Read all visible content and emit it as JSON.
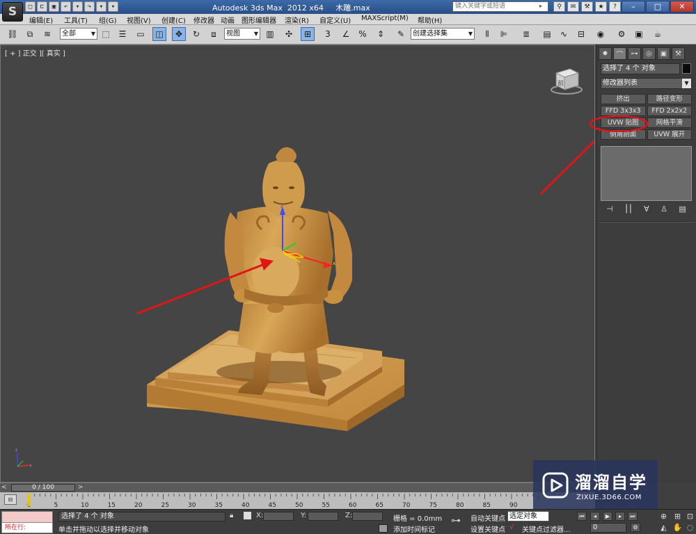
{
  "titlebar": {
    "title": "Autodesk 3ds Max  2012 x64     木雕.max",
    "search_placeholder": "键入关键字或短语",
    "app_logo": "3ds-max-logo",
    "window_controls": [
      "minimize",
      "maximize",
      "close"
    ]
  },
  "menu": {
    "items": [
      "编辑(E)",
      "工具(T)",
      "组(G)",
      "视图(V)",
      "创建(C)",
      "修改器",
      "动画",
      "图形编辑器",
      "渲染(R)",
      "自定义(U)",
      "MAXScript(M)",
      "帮助(H)"
    ]
  },
  "toolbar": {
    "selection_filter": "全部",
    "ref_coord": "视图",
    "named_selection": "创建选择集",
    "icons": [
      "link-icon",
      "unlink-icon",
      "bind-spacewarp-icon",
      "select-object-icon",
      "select-by-name-icon",
      "rect-selection-icon",
      "window-crossing-icon",
      "move-icon",
      "rotate-icon",
      "scale-icon",
      "pivot-icon",
      "manipulate-icon",
      "keyboard-shortcut-icon",
      "snap-3d-icon",
      "angle-snap-icon",
      "percent-snap-icon",
      "spinner-snap-icon",
      "edit-named-selection-icon",
      "mirror-icon",
      "align-icon",
      "layer-manager-icon",
      "ribbon-icon",
      "curve-editor-icon",
      "schematic-view-icon",
      "material-editor-icon",
      "render-setup-icon",
      "rendered-frame-icon",
      "render-icon"
    ]
  },
  "viewport": {
    "label": "[ + ] 正交 ][ 真实 ]",
    "viewcube_label": "前"
  },
  "command_panel": {
    "tabs": [
      "create-tab",
      "modify-tab",
      "hierarchy-tab",
      "motion-tab",
      "display-tab",
      "utilities-tab"
    ],
    "selection_info": "选择了 4 个 对象",
    "modifier_list": "修改器列表",
    "modifier_buttons": [
      "挤出",
      "路径变形",
      "FFD 3x3x3",
      "FFD 2x2x2",
      "UVW 贴图",
      "网格平滑",
      "倒角剖面",
      "UVW 展开"
    ],
    "highlighted": "UVW 贴图"
  },
  "timeline": {
    "frame_display": "0 / 100",
    "ticks": [
      "0",
      "5",
      "10",
      "15",
      "20",
      "25",
      "30",
      "35",
      "40",
      "45",
      "50",
      "55",
      "60",
      "65",
      "70",
      "75",
      "80",
      "85",
      "90"
    ]
  },
  "status": {
    "running": "所在行:",
    "selection": "选择了 4 个 对象",
    "prompt": "单击并拖动以选择并移动对象",
    "x_label": "X:",
    "y_label": "Y:",
    "z_label": "Z:",
    "grid": "栅格 = 0.0mm",
    "add_time_tag": "添加时间标记",
    "auto_key": "自动关键点",
    "set_key": "设置关键点",
    "selected_object": "选定对象",
    "key_filters": "关键点过滤器...",
    "frame": "0"
  },
  "watermark": {
    "title": "溜溜自学",
    "url": "ZIXUE.3D66.COM"
  },
  "colors": {
    "annotation_red": "#e01515",
    "titlebar_blue": "#2f5b98",
    "viewport_bg": "#454545",
    "wood": "#c9913f"
  }
}
